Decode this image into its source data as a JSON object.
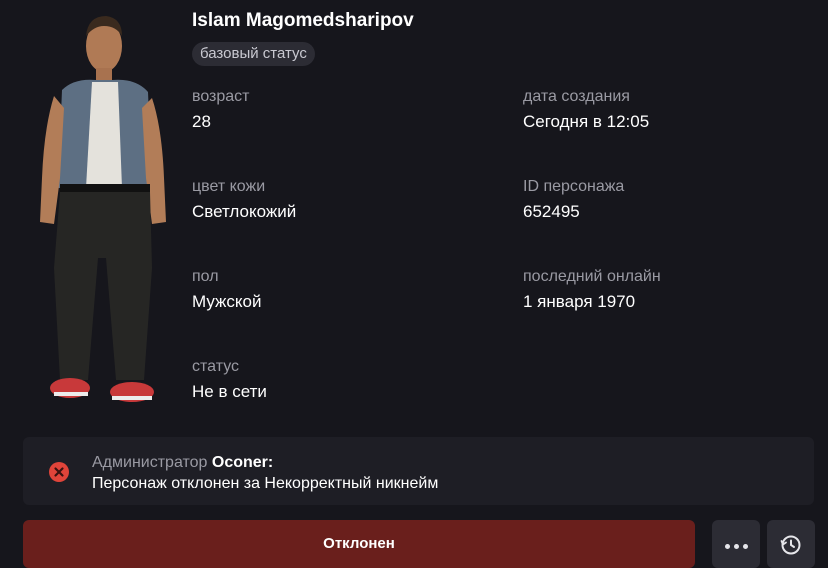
{
  "character": {
    "name": "Islam Magomedsharipov",
    "status_chip": "базовый статус",
    "fields": [
      {
        "label": "возраст",
        "value": "28"
      },
      {
        "label": "дата создания",
        "value": "Сегодня в 12:05"
      },
      {
        "label": "цвет кожи",
        "value": "Светлокожий"
      },
      {
        "label": "ID персонажа",
        "value": "652495"
      },
      {
        "label": "пол",
        "value": "Мужской"
      },
      {
        "label": "последний онлайн",
        "value": "1 января 1970"
      },
      {
        "label": "статус",
        "value": "Не в сети"
      }
    ]
  },
  "notice": {
    "icon": "close-circle-icon",
    "role": "Администратор",
    "admin_name": "Oconer:",
    "message": "Персонаж отклонен за Некорректный никнейм"
  },
  "actions": {
    "status_button_label": "Отклонен",
    "more_icon": "more-dots-icon",
    "history_icon": "history-icon"
  },
  "colors": {
    "background": "#16161c",
    "card": "#1e1e25",
    "reject": "#6a1f1c",
    "error_icon": "#e0443a"
  }
}
